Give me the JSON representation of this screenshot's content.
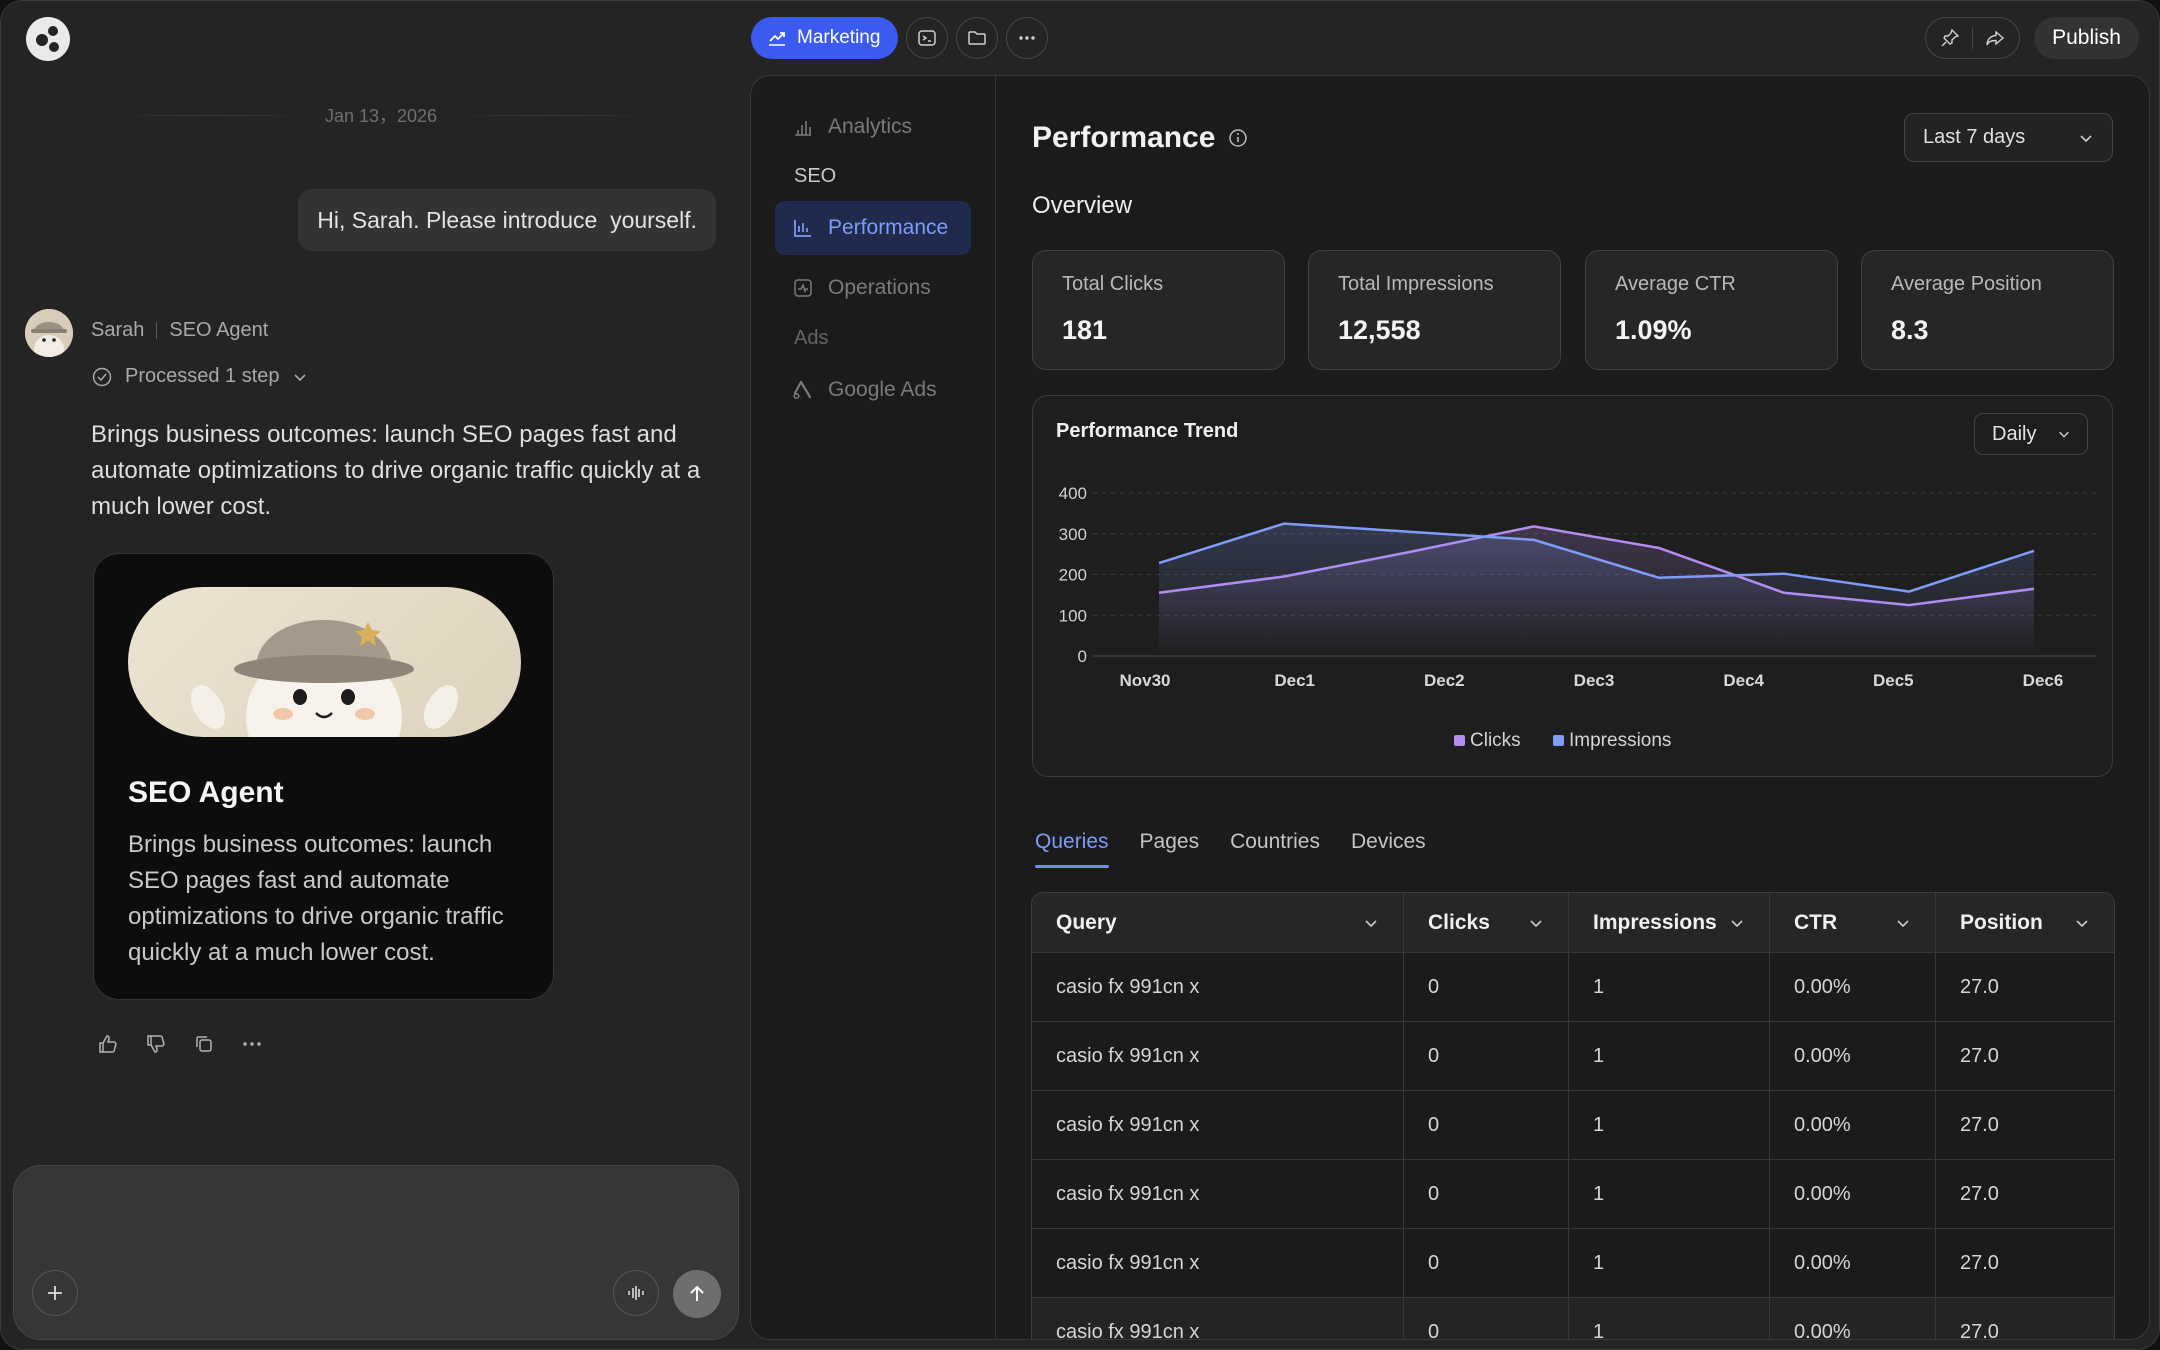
{
  "chat": {
    "date": "Jan 13，2026",
    "user_message": "Hi, Sarah. Please introduce  yourself.",
    "agent_name": "Sarah",
    "agent_role": "SEO Agent",
    "steps_label": "Processed 1 step",
    "reply": "Brings business outcomes: launch SEO pages fast and automate optimizations to drive organic traffic quickly at a much lower cost.",
    "card": {
      "title": "SEO Agent",
      "description": "Brings business outcomes: launch SEO pages fast and automate optimizations to drive organic traffic quickly at a much lower cost."
    }
  },
  "topbar": {
    "workspace": "Marketing",
    "publish": "Publish"
  },
  "sidebar": {
    "analytics": "Analytics",
    "seo_header": "SEO",
    "performance": "Performance",
    "operations": "Operations",
    "ads_header": "Ads",
    "google_ads": "Google Ads"
  },
  "main": {
    "title": "Performance",
    "range": "Last 7 days",
    "overview": "Overview",
    "stats": [
      {
        "label": "Total Clicks",
        "value": "181"
      },
      {
        "label": "Total Impressions",
        "value": "12,558"
      },
      {
        "label": "Average CTR",
        "value": "1.09%"
      },
      {
        "label": "Average Position",
        "value": "8.3"
      }
    ],
    "trend_title": "Performance Trend",
    "granularity": "Daily",
    "tabs": [
      "Queries",
      "Pages",
      "Countries",
      "Devices"
    ],
    "columns": [
      "Query",
      "Clicks",
      "Impressions",
      "CTR",
      "Position"
    ],
    "rows": [
      [
        "casio fx 991cn x",
        "0",
        "1",
        "0.00%",
        "27.0"
      ],
      [
        "casio fx 991cn x",
        "0",
        "1",
        "0.00%",
        "27.0"
      ],
      [
        "casio fx 991cn x",
        "0",
        "1",
        "0.00%",
        "27.0"
      ],
      [
        "casio fx 991cn x",
        "0",
        "1",
        "0.00%",
        "27.0"
      ],
      [
        "casio fx 991cn x",
        "0",
        "1",
        "0.00%",
        "27.0"
      ],
      [
        "casio fx 991cn x",
        "0",
        "1",
        "0.00%",
        "27.0"
      ]
    ]
  },
  "colors": {
    "accent": "#3b5bf0",
    "clicks": "#b58cf0",
    "impressions": "#7f9cf7"
  },
  "chart_data": {
    "type": "line",
    "title": "Performance Trend",
    "x": [
      "Nov30",
      "Dec1",
      "Dec2",
      "Dec3",
      "Dec4",
      "Dec5",
      "Dec6"
    ],
    "yticks": [
      0,
      100,
      200,
      300,
      400
    ],
    "ylim": [
      0,
      400
    ],
    "grid": true,
    "legend": "bottom-center",
    "series": [
      {
        "name": "Clicks",
        "color": "#b58cf0",
        "values": [
          155,
          195,
          255,
          318,
          265,
          155,
          125,
          165
        ]
      },
      {
        "name": "Impressions",
        "color": "#7f9cf7",
        "values": [
          228,
          325,
          305,
          285,
          192,
          202,
          158,
          258
        ]
      }
    ]
  }
}
